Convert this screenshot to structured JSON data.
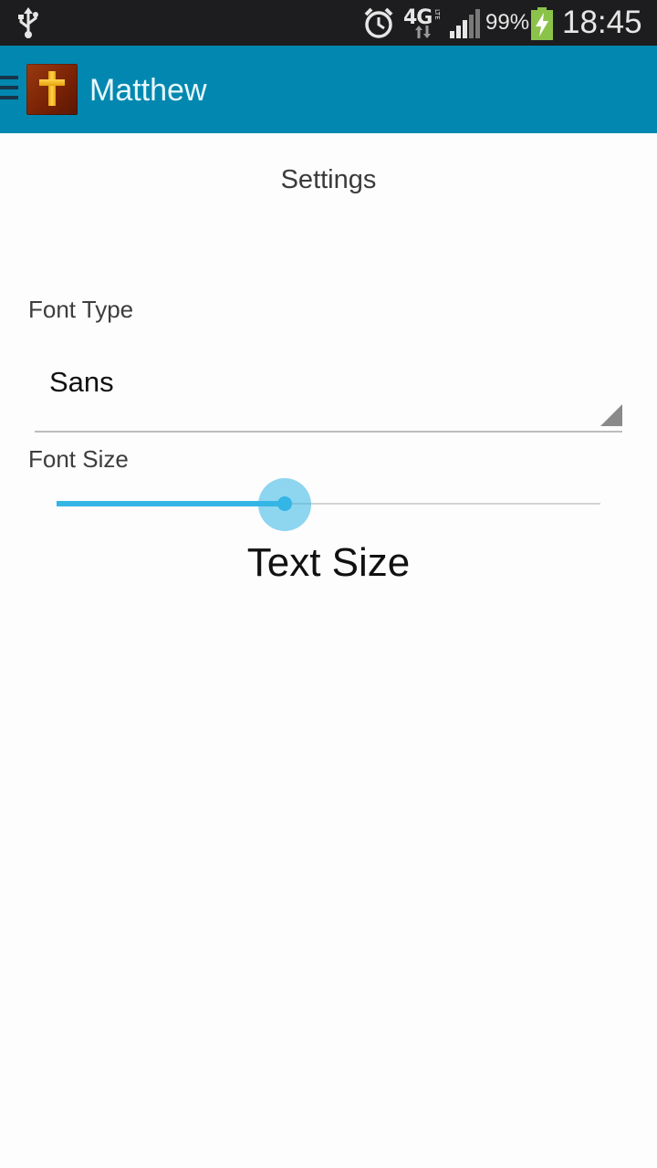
{
  "status_bar": {
    "network": "4G",
    "network_sub": "LTE",
    "battery_percent": "99%",
    "time": "18:45",
    "icons": [
      "usb-icon",
      "alarm-icon",
      "network-4g-icon",
      "signal-icon",
      "battery-charging-icon"
    ]
  },
  "action_bar": {
    "title": "Matthew",
    "icons": [
      "drawer-menu-icon",
      "app-cross-icon"
    ],
    "color": "#0288b0"
  },
  "settings": {
    "heading": "Settings",
    "font_type": {
      "label": "Font Type",
      "selected": "Sans"
    },
    "font_size": {
      "label": "Font Size",
      "value_fraction": 0.42,
      "preview_text": "Text Size"
    },
    "accent_color": "#33b5e5"
  }
}
